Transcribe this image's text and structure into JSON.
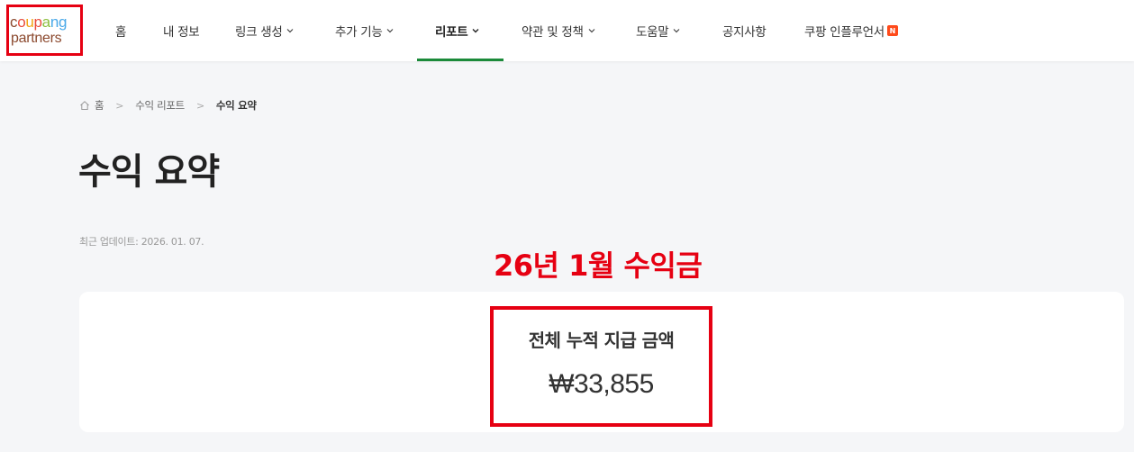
{
  "logo": {
    "line1": [
      {
        "ch": "c",
        "color": "#8c4a2f"
      },
      {
        "ch": "o",
        "color": "#e94c3c"
      },
      {
        "ch": "u",
        "color": "#f2a516"
      },
      {
        "ch": "p",
        "color": "#e94c3c"
      },
      {
        "ch": "a",
        "color": "#8cbf3f"
      },
      {
        "ch": "n",
        "color": "#4aa9e8"
      },
      {
        "ch": "g",
        "color": "#4aa9e8"
      }
    ],
    "line2": "partners"
  },
  "nav": {
    "items": [
      {
        "label": "홈",
        "has_dropdown": false,
        "active": false
      },
      {
        "label": "내 정보",
        "has_dropdown": false,
        "active": false
      },
      {
        "label": "링크 생성",
        "has_dropdown": true,
        "active": false
      },
      {
        "label": "추가 기능",
        "has_dropdown": true,
        "active": false
      },
      {
        "label": "리포트",
        "has_dropdown": true,
        "active": true
      },
      {
        "label": "약관 및 정책",
        "has_dropdown": true,
        "active": false
      },
      {
        "label": "도움말",
        "has_dropdown": true,
        "active": false
      },
      {
        "label": "공지사항",
        "has_dropdown": false,
        "active": false
      },
      {
        "label": "쿠팡 인플루언서",
        "has_dropdown": false,
        "active": false,
        "badge": "N"
      }
    ]
  },
  "breadcrumb": {
    "home": "홈",
    "level1": "수익 리포트",
    "current": "수익 요약"
  },
  "page": {
    "title": "수익 요약",
    "updated": "최근 업데이트: 2026. 01. 07.",
    "annotation": "26년 1월 수익금"
  },
  "summary": {
    "label": "전체 누적 지급 금액",
    "value": "₩33,855"
  },
  "colors": {
    "accent": "#1b8a3a",
    "highlight": "#e60012",
    "badge": "#ff4a1a"
  }
}
